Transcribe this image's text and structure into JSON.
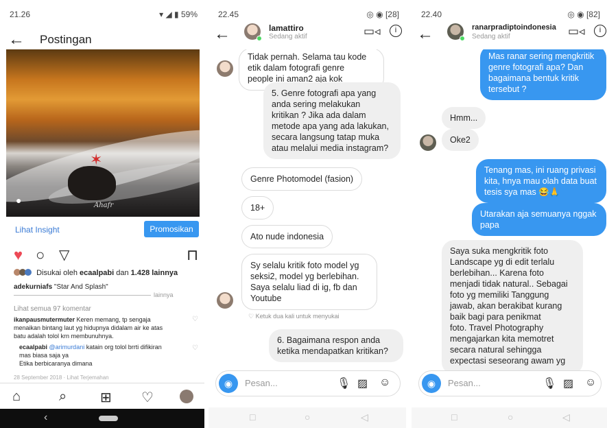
{
  "panel1": {
    "status_time": "21.26",
    "status_right": "59%",
    "title": "Postingan",
    "photo_signature": "Ahafr",
    "insight_link": "Lihat Insight",
    "promote_button": "Promosikan",
    "likes_prefix": "Disukai oleh",
    "likes_user": "ecaalpabi",
    "likes_mid": "dan",
    "likes_count": "1.428 lainnya",
    "caption_user": "adekurniafs",
    "caption_text": "\"Star And Splash\"",
    "caption_more": "lainnya",
    "view_all_comments": "Lihat semua 97 komentar",
    "comments": [
      {
        "user": "ikanpausmutermuter",
        "text_line1": "Keren memang, tp sengaja",
        "text_line2": "menaikan bintang laut yg hidupnya didalam air ke atas",
        "text_line3": "batu adalah tolol krn membunuhnya."
      },
      {
        "user": "ecaalpabi",
        "mention": "@arimurdani",
        "text_line1": "katain org tolol brrti difikiran",
        "text_line2": "mas biasa saja ya",
        "text_line3": "Etika berbicaranya dimana"
      }
    ],
    "post_date": "28 September 2018 · Lihat Terjemahan"
  },
  "panel2": {
    "status_time": "22.45",
    "status_right": "28",
    "contact_name": "lamattiro",
    "contact_status": "Sedang aktif",
    "messages": [
      {
        "dir": "in",
        "line1": "Tidak pernah. Selama tau kode",
        "line2": "etik dalam fotografi genre",
        "line3": "people ini aman2 aja kok"
      },
      {
        "dir": "out",
        "line1": "5. Genre fotografi apa yang",
        "line2": "anda sering melakukan",
        "line3": "kritikan ? Jika ada dalam",
        "line4": "metode apa yang ada lakukan,",
        "line5": "secara langsung tatap muka",
        "line6": "atau melalui media instagram?"
      },
      {
        "dir": "in",
        "line1": "Genre Photomodel (fasion)"
      },
      {
        "dir": "in",
        "line1": "18+"
      },
      {
        "dir": "in",
        "line1": "Ato nude indonesia"
      },
      {
        "dir": "in",
        "line1": "Sy selalu kritik foto model yg",
        "line2": "seksi2, model yg berlebihan.",
        "line3": "Saya selalu liad di ig, fb dan",
        "line4": "Youtube"
      },
      {
        "dir": "out",
        "line1": "6. Bagaimana respon anda",
        "line2": "ketika mendapatkan kritikan?"
      }
    ],
    "like_hint": "Ketuk dua kali untuk menyukai",
    "composer_placeholder": "Pesan..."
  },
  "panel3": {
    "status_time": "22.40",
    "status_right": "82",
    "contact_name": "ranarpradiptoindonesia",
    "contact_status": "Sedang aktif",
    "messages": [
      {
        "dir": "out",
        "line1": "Mas ranar sering mengkritik",
        "line2": "genre fotografi apa? Dan",
        "line3": "bagaimana bentuk kritik",
        "line4": "tersebut ?"
      },
      {
        "dir": "in",
        "line1": "Hmm..."
      },
      {
        "dir": "in",
        "line1": "Oke2"
      },
      {
        "dir": "out",
        "line1": "Tenang mas, ini ruang privasi",
        "line2": "kita, hnya mau olah data buat",
        "line3": "tesis sya mas 😂🙏"
      },
      {
        "dir": "out",
        "line1": "Utarakan aja semuanya nggak",
        "line2": "papa"
      },
      {
        "dir": "in",
        "line1": "Saya suka mengkritik foto",
        "line2": "Landscape yg di edit terlalu",
        "line3": "berlebihan... Karena foto",
        "line4": "menjadi tidak natural.. Sebagai",
        "line5": "foto yg memiliki  Tanggung",
        "line6": "jawab, akan berakibat kurang",
        "line7": "baik bagi para penikmat",
        "line8": "foto. Travel Photography",
        "line9": "mengajarkan kita memotret",
        "line10": "secara natural sehingga",
        "line11": "expectasi seseorang awam yg"
      }
    ],
    "composer_placeholder": "Pesan..."
  },
  "colors": {
    "accent_blue": "#3897f0",
    "like_red": "#ed4956",
    "online_green": "#4cd964"
  }
}
